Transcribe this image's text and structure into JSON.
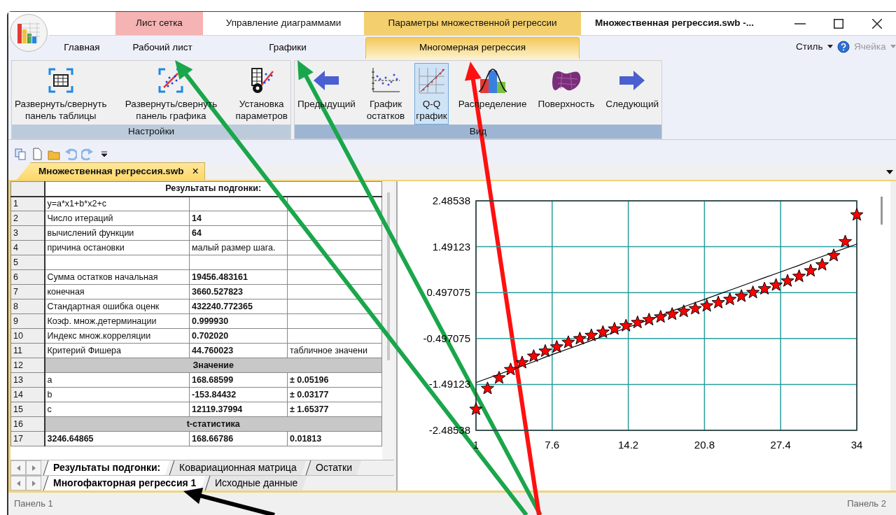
{
  "window": {
    "title": "Множественная регрессия.swb -..."
  },
  "context_tabs": [
    {
      "label": "Лист сетка",
      "color": "#f6b3b3"
    },
    {
      "label": "Управление диаграммами",
      "color": "#ffffff"
    },
    {
      "label": "Параметры множественной регрессии",
      "color": "#f3cf6e"
    }
  ],
  "ribbon_tabs": [
    {
      "label": "Главная",
      "selected": false
    },
    {
      "label": "Рабочий лист",
      "selected": false
    },
    {
      "label": "Графики",
      "selected": false
    },
    {
      "label": "Многомерная регрессия",
      "selected": true
    }
  ],
  "ribbon_right": [
    {
      "label": "Стиль",
      "disabled": false
    },
    {
      "label": "Ячейка",
      "disabled": true
    }
  ],
  "ribbon_groups": [
    {
      "title": "Настройки",
      "buttons": [
        {
          "kind": "table-panel",
          "lines": [
            "Развернуть/свернуть",
            "панель таблицы"
          ],
          "selected": false
        },
        {
          "kind": "chart-panel",
          "lines": [
            "Развернуть/свернуть",
            "панель графика"
          ],
          "selected": false
        },
        {
          "kind": "settings",
          "lines": [
            "Установка",
            "параметров"
          ],
          "selected": false
        }
      ]
    },
    {
      "title": "Вид",
      "buttons": [
        {
          "kind": "previous",
          "lines": [
            "Предыдущий"
          ],
          "selected": false
        },
        {
          "kind": "residuals",
          "lines": [
            "График",
            "остатков"
          ],
          "selected": false
        },
        {
          "kind": "qq",
          "lines": [
            "Q-Q",
            "график"
          ],
          "selected": true
        },
        {
          "kind": "distribution",
          "lines": [
            "Распределение"
          ],
          "selected": false
        },
        {
          "kind": "surface",
          "lines": [
            "Поверхность"
          ],
          "selected": false
        },
        {
          "kind": "next",
          "lines": [
            "Следующий"
          ],
          "selected": false
        }
      ]
    }
  ],
  "document_tab": {
    "label": "Множественная регрессия.swb",
    "close": "×"
  },
  "table": {
    "header": "Результаты подгонки:",
    "rows": [
      {
        "num": "1",
        "kind": "data",
        "cells": [
          {
            "text": "y=a*x1+b*x2+c",
            "bold": false
          },
          {},
          {}
        ]
      },
      {
        "num": "2",
        "kind": "data",
        "cells": [
          {
            "text": "Число итераций",
            "bold": false
          },
          {
            "text": "14",
            "bold": true
          },
          {}
        ]
      },
      {
        "num": "3",
        "kind": "data",
        "cells": [
          {
            "text": "вычислений функции",
            "bold": false
          },
          {
            "text": "64",
            "bold": true
          },
          {}
        ]
      },
      {
        "num": "4",
        "kind": "data",
        "cells": [
          {
            "text": "причина остановки",
            "bold": false
          },
          {
            "text": "малый размер шага.",
            "bold": false
          },
          {}
        ]
      },
      {
        "num": "5",
        "kind": "data",
        "cells": [
          {},
          {},
          {}
        ]
      },
      {
        "num": "6",
        "kind": "data",
        "cells": [
          {
            "text": "Сумма остатков начальная",
            "bold": false
          },
          {
            "text": "19456.483161",
            "bold": true
          },
          {}
        ]
      },
      {
        "num": "7",
        "kind": "data",
        "cells": [
          {
            "text": "конечная",
            "bold": false
          },
          {
            "text": "3660.527823",
            "bold": true
          },
          {}
        ]
      },
      {
        "num": "8",
        "kind": "data",
        "cells": [
          {
            "text": "Стандартная ошибка оценк",
            "bold": false
          },
          {
            "text": "432240.772365",
            "bold": true
          },
          {}
        ]
      },
      {
        "num": "9",
        "kind": "data",
        "cells": [
          {
            "text": "Коэф. множ.детерминации",
            "bold": false
          },
          {
            "text": "0.999930",
            "bold": true
          },
          {}
        ]
      },
      {
        "num": "10",
        "kind": "data",
        "cells": [
          {
            "text": "Индекс множ.корреляции",
            "bold": false
          },
          {
            "text": "0.702020",
            "bold": true
          },
          {}
        ]
      },
      {
        "num": "11",
        "kind": "data",
        "cells": [
          {
            "text": "Критерий Фишера",
            "bold": false
          },
          {
            "text": "44.760023",
            "bold": true
          },
          {
            "text": "табличное значени",
            "bold": false
          }
        ]
      },
      {
        "num": "12",
        "kind": "section",
        "title": "Значение"
      },
      {
        "num": "13",
        "kind": "data",
        "cells": [
          {
            "text": "a",
            "bold": false
          },
          {
            "text": "168.68599",
            "bold": true
          },
          {
            "text": "± 0.05196",
            "bold": true
          }
        ]
      },
      {
        "num": "14",
        "kind": "data",
        "cells": [
          {
            "text": "b",
            "bold": false
          },
          {
            "text": "-153.84432",
            "bold": true
          },
          {
            "text": "± 0.03177",
            "bold": true
          }
        ]
      },
      {
        "num": "15",
        "kind": "data",
        "cells": [
          {
            "text": "c",
            "bold": false
          },
          {
            "text": "12119.37994",
            "bold": true
          },
          {
            "text": "± 1.65377",
            "bold": true
          }
        ]
      },
      {
        "num": "16",
        "kind": "section",
        "title": "t-статистика"
      },
      {
        "num": "17",
        "kind": "data",
        "cells": [
          {
            "text": "3246.64865",
            "bold": true
          },
          {
            "text": "168.66786",
            "bold": true
          },
          {
            "text": "0.01813",
            "bold": true
          }
        ]
      }
    ]
  },
  "sheet_tabs": [
    {
      "label": "Результаты подгонки:",
      "selected": true
    },
    {
      "label": "Ковариационная матрица",
      "selected": false
    },
    {
      "label": "Остатки",
      "selected": false
    }
  ],
  "workbook_tabs": [
    {
      "label": "Многофакторная регрессия 1",
      "selected": true
    },
    {
      "label": "Исходные данные",
      "selected": false
    }
  ],
  "chart": {
    "chart_data": {
      "type": "scatter",
      "x": [
        1,
        2,
        3,
        4,
        5,
        6,
        7,
        8,
        9,
        10,
        11,
        12,
        13,
        14,
        15,
        16,
        17,
        18,
        19,
        20,
        21,
        22,
        23,
        24,
        25,
        26,
        27,
        28,
        29,
        30,
        31,
        32,
        33,
        34
      ],
      "series": [
        {
          "type": "scatter",
          "color": "#ff0000",
          "values": [
            -2.03,
            -1.58,
            -1.35,
            -1.17,
            -1.02,
            -0.88,
            -0.77,
            -0.68,
            -0.58,
            -0.5,
            -0.43,
            -0.36,
            -0.29,
            -0.22,
            -0.15,
            -0.09,
            -0.03,
            0.03,
            0.09,
            0.15,
            0.21,
            0.28,
            0.35,
            0.42,
            0.5,
            0.58,
            0.66,
            0.75,
            0.85,
            0.97,
            1.1,
            1.3,
            1.6,
            2.18
          ]
        },
        {
          "type": "line",
          "color": "#000000",
          "values": [
            -1.45,
            -1.36,
            -1.27,
            -1.18,
            -1.09,
            -1.0,
            -0.9,
            -0.81,
            -0.72,
            -0.63,
            -0.54,
            -0.45,
            -0.36,
            -0.27,
            -0.18,
            -0.09,
            0.0,
            0.1,
            0.19,
            0.28,
            0.37,
            0.46,
            0.55,
            0.64,
            0.73,
            0.82,
            0.91,
            1.0,
            1.09,
            1.19,
            1.28,
            1.37,
            1.46,
            1.55
          ]
        }
      ],
      "grid": true,
      "xlim": [
        1,
        34
      ],
      "ylim": [
        -2.48538,
        2.48538
      ],
      "xticks": [
        1,
        {
          "value": 7.6,
          "label": "7.6"
        },
        {
          "value": 14.2,
          "label": "14.2"
        },
        {
          "value": 20.8,
          "label": "20.8"
        },
        {
          "value": 27.4,
          "label": "27.4"
        },
        34
      ],
      "yticks": [
        {
          "value": -2.48538,
          "label": "-2.48538"
        },
        {
          "value": -1.49123,
          "label": "-1.49123"
        },
        {
          "value": -0.497075,
          "label": "-0.497075"
        },
        {
          "value": 0.497075,
          "label": "0.497075"
        },
        {
          "value": 1.49123,
          "label": "1.49123"
        },
        {
          "value": 2.48538,
          "label": "2.48538"
        }
      ]
    }
  },
  "status_bar": [
    "Панель 1",
    "Панель 2"
  ],
  "arrows": [
    {
      "color": "#1aa64b"
    },
    {
      "color": "#1aa64b"
    },
    {
      "color": "#ff1010"
    },
    {
      "color": "#000000"
    }
  ]
}
